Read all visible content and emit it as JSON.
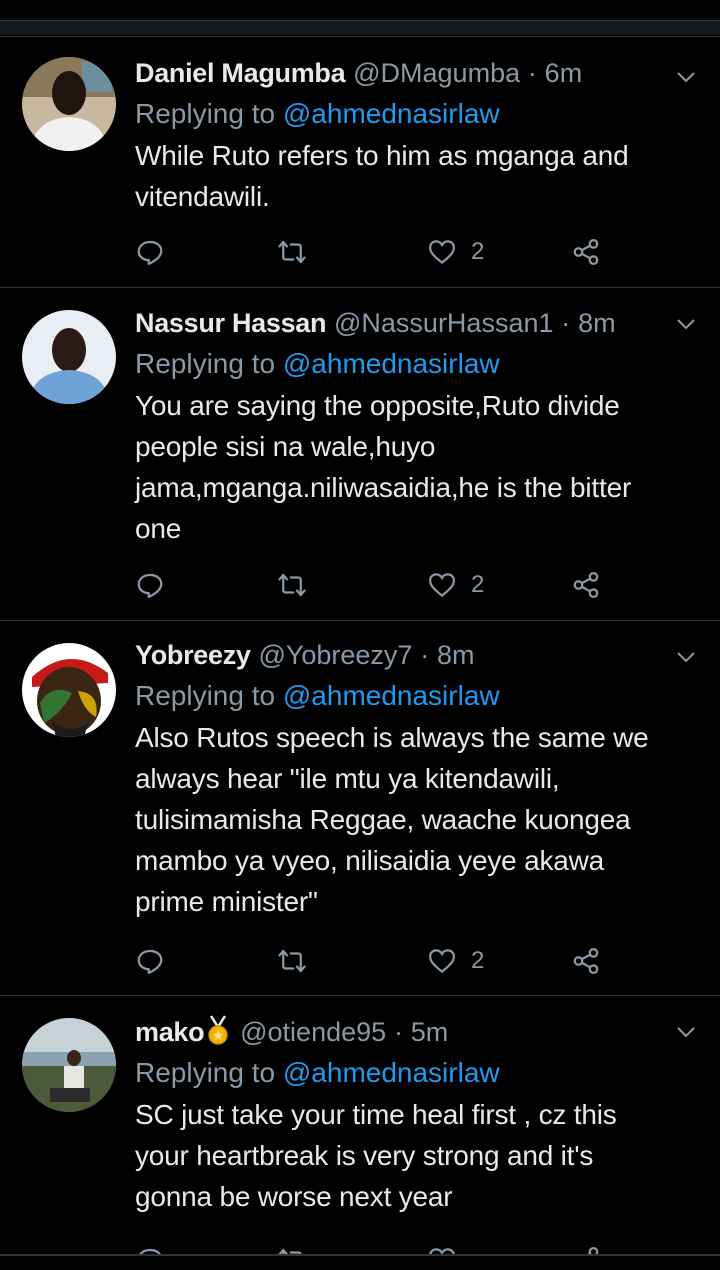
{
  "tweets": [
    {
      "name": "Daniel Magumba",
      "handle": "@DMagumba",
      "time": "6m",
      "replying_prefix": "Replying to",
      "replying_to": "@ahmednasirlaw",
      "text_lines": [
        "While Ruto refers to him as mganga and",
        "vitendawili."
      ],
      "likes": "2"
    },
    {
      "name": "Nassur Hassan",
      "handle": "@NassurHassan1",
      "time": "8m",
      "replying_prefix": "Replying to",
      "replying_to": "@ahmednasirlaw",
      "text_lines": [
        "You are saying the opposite,Ruto divide",
        "people sisi na wale,huyo",
        "jama,mganga.niliwasaidia,he is the bitter",
        "one"
      ],
      "likes": "2"
    },
    {
      "name": "Yobreezy",
      "handle": "@Yobreezy7",
      "time": "8m",
      "replying_prefix": "Replying to",
      "replying_to": "@ahmednasirlaw",
      "text_lines": [
        "Also Rutos speech is always the same we",
        "always hear \"ile mtu ya kitendawili,",
        "tulisimamisha Reggae, waache kuongea",
        "mambo ya vyeo, nilisaidia yeye akawa",
        "prime minister\""
      ],
      "likes": "2"
    },
    {
      "name": "mako",
      "handle": "@otiende95",
      "time": "5m",
      "replying_prefix": "Replying to",
      "replying_to": "@ahmednasirlaw",
      "text_lines": [
        "SC just take your time heal first , cz this",
        "your heartbreak is very strong and it's",
        "gonna be worse next year"
      ],
      "likes": ""
    }
  ],
  "separator": "·",
  "icons": {
    "reply": "reply-icon",
    "retweet": "retweet-icon",
    "like": "heart-icon",
    "share": "share-icon",
    "menu": "chevron-down-icon",
    "medal": "medal-icon"
  },
  "colors": {
    "background": "#000000",
    "link": "#1d9bf0",
    "muted": "#8b98a5",
    "text": "#e7e9ea"
  }
}
